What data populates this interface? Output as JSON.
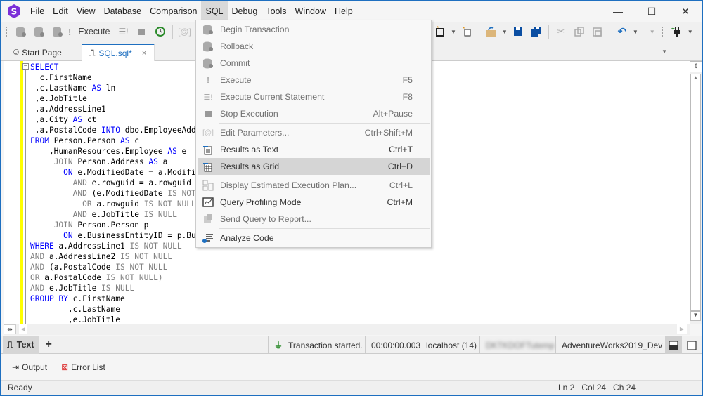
{
  "app": {
    "logo_letter": "S",
    "accent_color": "#1e6fc0",
    "logo_color": "#7b2fd8"
  },
  "menubar": {
    "items": [
      {
        "label": "File",
        "active": false
      },
      {
        "label": "Edit",
        "active": false
      },
      {
        "label": "View",
        "active": false
      },
      {
        "label": "Database",
        "active": false
      },
      {
        "label": "Comparison",
        "active": false
      },
      {
        "label": "SQL",
        "active": true
      },
      {
        "label": "Debug",
        "active": false
      },
      {
        "label": "Tools",
        "active": false
      },
      {
        "label": "Window",
        "active": false
      },
      {
        "label": "Help",
        "active": false
      }
    ]
  },
  "window_controls": {
    "minimize": "—",
    "maximize": "☐",
    "close": "✕"
  },
  "toolbar": {
    "execute_label": "Execute",
    "icons": [
      "begin-transaction-icon",
      "rollback-icon",
      "commit-icon",
      "execute-icon",
      "execute-statement-icon",
      "stop-icon",
      "history-icon",
      "edit-parameters-icon",
      "new-sql-icon",
      "new-file-icon",
      "open-icon",
      "save-icon",
      "save-all-icon",
      "cut-icon",
      "copy-icon",
      "paste-icon",
      "undo-icon",
      "connect-icon"
    ]
  },
  "tabs": [
    {
      "label": "Start Page",
      "active": false
    },
    {
      "label": "SQL.sql*",
      "active": true,
      "close": "×"
    }
  ],
  "editor": {
    "lines": [
      [
        {
          "t": "SELECT",
          "c": "kw"
        }
      ],
      [
        {
          "t": "  c.FirstName",
          "c": ""
        }
      ],
      [
        {
          "t": " ,c.LastName ",
          "c": ""
        },
        {
          "t": "AS",
          "c": "kw"
        },
        {
          "t": " ln",
          "c": ""
        }
      ],
      [
        {
          "t": " ,e.JobTitle",
          "c": ""
        }
      ],
      [
        {
          "t": " ,a.AddressLine1",
          "c": ""
        }
      ],
      [
        {
          "t": " ,a.City ",
          "c": ""
        },
        {
          "t": "AS",
          "c": "kw"
        },
        {
          "t": " ct",
          "c": ""
        }
      ],
      [
        {
          "t": " ,a.PostalCode ",
          "c": ""
        },
        {
          "t": "INTO",
          "c": "kw"
        },
        {
          "t": " dbo.EmployeeAddresses",
          "c": ""
        }
      ],
      [
        {
          "t": "FROM",
          "c": "kw"
        },
        {
          "t": " Person.Person ",
          "c": ""
        },
        {
          "t": "AS",
          "c": "kw"
        },
        {
          "t": " c",
          "c": ""
        }
      ],
      [
        {
          "t": "    ,HumanResources.Employee ",
          "c": ""
        },
        {
          "t": "AS",
          "c": "kw"
        },
        {
          "t": " e",
          "c": ""
        }
      ],
      [
        {
          "t": "     ",
          "c": ""
        },
        {
          "t": "JOIN",
          "c": "gr"
        },
        {
          "t": " Person.Address ",
          "c": ""
        },
        {
          "t": "AS",
          "c": "kw"
        },
        {
          "t": " a",
          "c": ""
        }
      ],
      [
        {
          "t": "       ",
          "c": ""
        },
        {
          "t": "ON",
          "c": "kw"
        },
        {
          "t": " e.ModifiedDate = a.ModifiedDate",
          "c": ""
        }
      ],
      [
        {
          "t": "         ",
          "c": ""
        },
        {
          "t": "AND",
          "c": "gr"
        },
        {
          "t": " e.rowguid = a.rowguid",
          "c": ""
        }
      ],
      [
        {
          "t": "         ",
          "c": ""
        },
        {
          "t": "AND",
          "c": "gr"
        },
        {
          "t": " (e.ModifiedDate ",
          "c": ""
        },
        {
          "t": "IS NOT NULL",
          "c": "gr"
        }
      ],
      [
        {
          "t": "           ",
          "c": ""
        },
        {
          "t": "OR",
          "c": "gr"
        },
        {
          "t": " a.rowguid ",
          "c": ""
        },
        {
          "t": "IS NOT NULL",
          "c": "gr"
        }
      ],
      [
        {
          "t": "         ",
          "c": ""
        },
        {
          "t": "AND",
          "c": "gr"
        },
        {
          "t": " e.JobTitle ",
          "c": ""
        },
        {
          "t": "IS NULL",
          "c": "gr"
        }
      ],
      [
        {
          "t": "     ",
          "c": ""
        },
        {
          "t": "JOIN",
          "c": "gr"
        },
        {
          "t": " Person.Person p",
          "c": ""
        }
      ],
      [
        {
          "t": "       ",
          "c": ""
        },
        {
          "t": "ON",
          "c": "kw"
        },
        {
          "t": " e.BusinessEntityID = p.BusinessEntityID",
          "c": ""
        }
      ],
      [
        {
          "t": "WHERE",
          "c": "kw"
        },
        {
          "t": " a.AddressLine1 ",
          "c": ""
        },
        {
          "t": "IS NOT NULL",
          "c": "gr"
        }
      ],
      [
        {
          "t": "AND",
          "c": "gr"
        },
        {
          "t": " a.AddressLine2 ",
          "c": ""
        },
        {
          "t": "IS NOT NULL",
          "c": "gr"
        }
      ],
      [
        {
          "t": "AND",
          "c": "gr"
        },
        {
          "t": " (a.PostalCode ",
          "c": ""
        },
        {
          "t": "IS NOT NULL",
          "c": "gr"
        }
      ],
      [
        {
          "t": "OR",
          "c": "gr"
        },
        {
          "t": " a.PostalCode ",
          "c": ""
        },
        {
          "t": "IS NOT NULL)",
          "c": "gr"
        }
      ],
      [
        {
          "t": "AND",
          "c": "gr"
        },
        {
          "t": " e.JobTitle ",
          "c": ""
        },
        {
          "t": "IS NULL",
          "c": "gr"
        }
      ],
      [
        {
          "t": "GROUP BY",
          "c": "kw"
        },
        {
          "t": " c.FirstName",
          "c": ""
        }
      ],
      [
        {
          "t": "        ,c.LastName",
          "c": ""
        }
      ],
      [
        {
          "t": "        ,e.JobTitle",
          "c": ""
        }
      ]
    ]
  },
  "sql_menu": {
    "items": [
      {
        "label": "Begin Transaction",
        "shortcut": "",
        "icon": "begin-transaction-icon",
        "disabled": true
      },
      {
        "label": "Rollback",
        "shortcut": "",
        "icon": "rollback-icon",
        "disabled": true
      },
      {
        "label": "Commit",
        "shortcut": "",
        "icon": "commit-icon",
        "disabled": true
      },
      {
        "label": "Execute",
        "shortcut": "F5",
        "icon": "execute-icon",
        "disabled": true
      },
      {
        "label": "Execute Current Statement",
        "shortcut": "F8",
        "icon": "execute-statement-icon",
        "disabled": true
      },
      {
        "label": "Stop Execution",
        "shortcut": "Alt+Pause",
        "icon": "stop-icon",
        "disabled": true
      },
      {
        "separator": true
      },
      {
        "label": "Edit Parameters...",
        "shortcut": "Ctrl+Shift+M",
        "icon": "edit-parameters-icon",
        "disabled": true
      },
      {
        "label": "Results as Text",
        "shortcut": "Ctrl+T",
        "icon": "results-text-icon",
        "disabled": false
      },
      {
        "label": "Results as Grid",
        "shortcut": "Ctrl+D",
        "icon": "results-grid-icon",
        "disabled": false,
        "highlighted": true
      },
      {
        "separator": true
      },
      {
        "label": "Display Estimated Execution Plan...",
        "shortcut": "Ctrl+L",
        "icon": "execution-plan-icon",
        "disabled": true
      },
      {
        "label": "Query Profiling Mode",
        "shortcut": "Ctrl+M",
        "icon": "profiling-icon",
        "disabled": false
      },
      {
        "label": "Send Query to Report...",
        "shortcut": "",
        "icon": "report-icon",
        "disabled": true
      },
      {
        "separator": true
      },
      {
        "label": "Analyze Code",
        "shortcut": "",
        "icon": "analyze-code-icon",
        "disabled": false
      }
    ]
  },
  "docbar": {
    "text_tab": "Text",
    "add": "+",
    "transaction_status": "Transaction started.",
    "elapsed": "00:00:00.003",
    "server": "localhost (14)",
    "user_blurred": "DKTKDOFTutemp",
    "database": "AdventureWorks2019_Dev"
  },
  "output_tabs": [
    {
      "label": "Output",
      "icon": "output-icon"
    },
    {
      "label": "Error List",
      "icon": "error-list-icon"
    }
  ],
  "statusbar": {
    "state": "Ready",
    "ln": "Ln 2",
    "col": "Col 24",
    "ch": "Ch 24"
  }
}
